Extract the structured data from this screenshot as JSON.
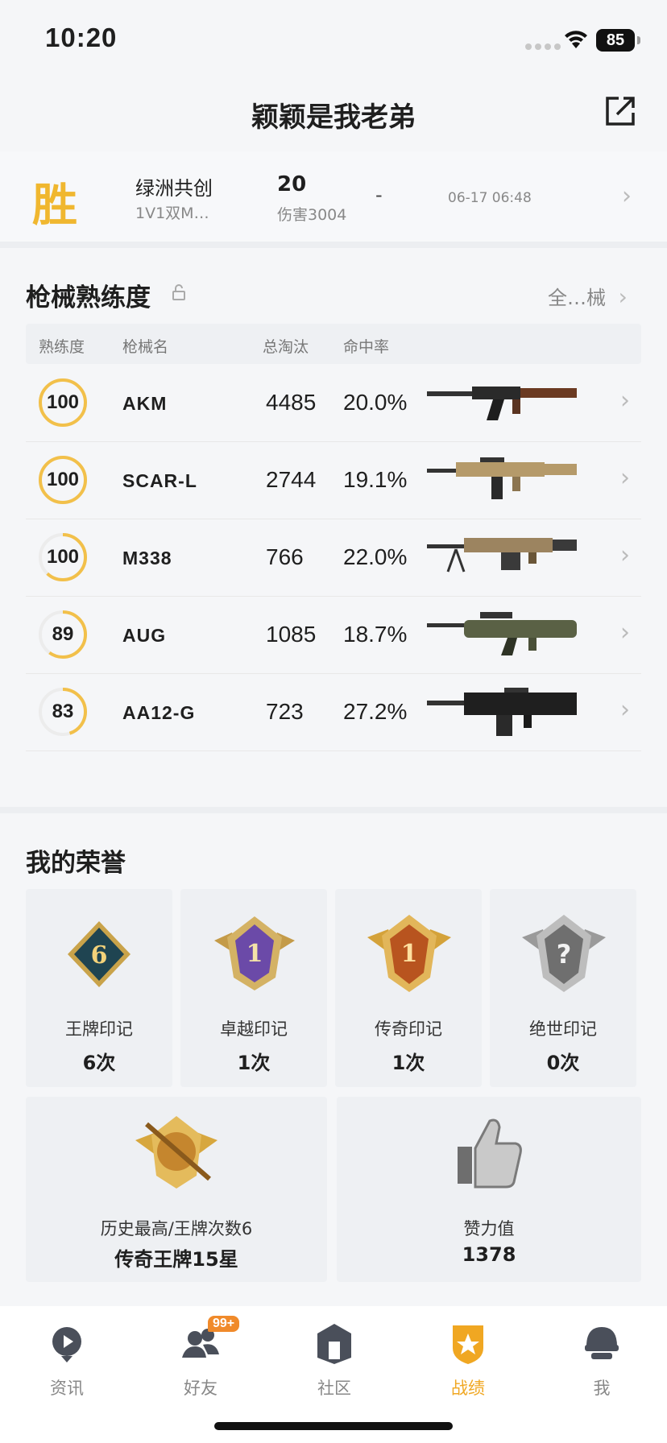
{
  "status_bar": {
    "time": "10:20",
    "battery": "85"
  },
  "header": {
    "title": "颖颖是我老弟"
  },
  "recent_match": {
    "result": "胜",
    "map": "绿洲共创",
    "mode": "1V1双M…",
    "kills": "20",
    "damage": "伤害3004",
    "rank": "-",
    "time": "06-17 06:48"
  },
  "weapon_section": {
    "title": "枪械熟练度",
    "all_link": "全…械",
    "columns": {
      "proficiency": "熟练度",
      "name": "枪械名",
      "kills": "总淘汰",
      "accuracy": "命中率"
    },
    "rows": [
      {
        "proficiency": "100",
        "progress": 1.0,
        "name": "AKM",
        "kills": "4485",
        "accuracy": "20.0%"
      },
      {
        "proficiency": "100",
        "progress": 1.0,
        "name": "SCAR-L",
        "kills": "2744",
        "accuracy": "19.1%"
      },
      {
        "proficiency": "100",
        "progress": 0.62,
        "name": "M338",
        "kills": "766",
        "accuracy": "22.0%"
      },
      {
        "proficiency": "89",
        "progress": 0.6,
        "name": "AUG",
        "kills": "1085",
        "accuracy": "18.7%"
      },
      {
        "proficiency": "83",
        "progress": 0.45,
        "name": "AA12-G",
        "kills": "723",
        "accuracy": "27.2%"
      }
    ]
  },
  "honor_section": {
    "title": "我的荣誉",
    "marks": [
      {
        "label": "王牌印记",
        "count": "6次"
      },
      {
        "label": "卓越印记",
        "count": "1次"
      },
      {
        "label": "传奇印记",
        "count": "1次"
      },
      {
        "label": "绝世印记",
        "count": "0次"
      }
    ],
    "highest": {
      "label": "历史最高/王牌次数6",
      "value": "传奇王牌15星"
    },
    "likes": {
      "label": "赞力值",
      "value": "1378"
    }
  },
  "tab_bar": {
    "tabs": [
      {
        "label": "资讯"
      },
      {
        "label": "好友",
        "badge": "99+"
      },
      {
        "label": "社区"
      },
      {
        "label": "战绩"
      },
      {
        "label": "我"
      }
    ]
  },
  "colors": {
    "accent": "#f0a722",
    "ring": "#f2c04a"
  }
}
